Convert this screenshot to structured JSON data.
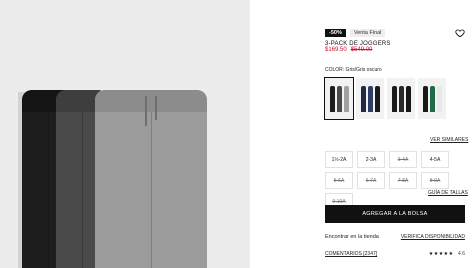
{
  "product": {
    "badge_discount": "-50%",
    "badge_final": "Venta Final",
    "title": "3-PACK DE JOGGERS",
    "price_now": "$169.50",
    "price_old": "$549.00",
    "color_label": "COLOR: Gris/Gris oscuro"
  },
  "swatches": [
    {
      "name": "Gris/Gris oscuro",
      "colors": [
        "#1c1c1c",
        "#4a4a4a",
        "#a0a0a0"
      ]
    },
    {
      "name": "Azul marino",
      "colors": [
        "#1f2a44",
        "#2f3d66",
        "#1a1a1a"
      ]
    },
    {
      "name": "Negro",
      "colors": [
        "#1b1b1b",
        "#2a2a2a",
        "#171717"
      ]
    },
    {
      "name": "Verde",
      "colors": [
        "#1a1a1a",
        "#1f6b45",
        "#e8e8e8"
      ]
    }
  ],
  "links": {
    "similar": "VER SIMILARES",
    "size_guide": "GUÍA DE TALLAS"
  },
  "sizes": [
    {
      "label": "1½-2A",
      "available": true
    },
    {
      "label": "2-3A",
      "available": true
    },
    {
      "label": "3-4A",
      "available": false
    },
    {
      "label": "4-5A",
      "available": true
    },
    {
      "label": "5-6A",
      "available": false
    },
    {
      "label": "6-7A",
      "available": false
    },
    {
      "label": "7-8A",
      "available": false
    },
    {
      "label": "8-9A",
      "available": false
    },
    {
      "label": "9-10A",
      "available": false
    }
  ],
  "cart": {
    "add_label": "AGREGAR A LA BOLSA"
  },
  "store": {
    "find_label": "Encontrar en la tienda",
    "check_label": "VERIFICA DISPONIBILIDAD"
  },
  "reviews": {
    "label": "COMENTARIOS [2347]",
    "stars": "★★★★★",
    "rating": "4.6"
  },
  "colors": {
    "sale_red": "#c8102e",
    "button_black": "#111111"
  }
}
